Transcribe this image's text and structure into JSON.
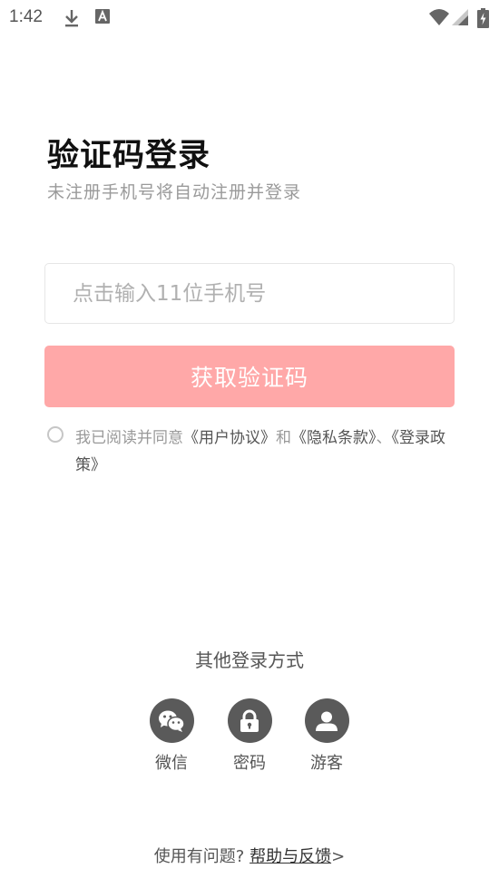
{
  "status_bar": {
    "time": "1:42",
    "icons": [
      "download-icon",
      "text-a-icon",
      "wifi-icon",
      "signal-icon",
      "battery-charging-icon"
    ]
  },
  "login": {
    "title": "验证码登录",
    "subtitle": "未注册手机号将自动注册并登录",
    "phone_placeholder": "点击输入11位手机号",
    "phone_value": "",
    "get_code_label": "获取验证码",
    "button_color": "#ffa8a8"
  },
  "agreement": {
    "prefix": "我已阅读并同意",
    "user_agreement": "《用户协议》",
    "and": "和",
    "privacy_terms": "《隐私条款》",
    "separator": "、",
    "login_policy": "《登录政策》"
  },
  "other_login": {
    "title": "其他登录方式",
    "options": [
      {
        "label": "微信",
        "icon": "wechat-icon"
      },
      {
        "label": "密码",
        "icon": "lock-icon"
      },
      {
        "label": "游客",
        "icon": "user-icon"
      }
    ]
  },
  "footer": {
    "question": "使用有问题?",
    "help_link": "帮助与反馈",
    "arrow": ">"
  }
}
